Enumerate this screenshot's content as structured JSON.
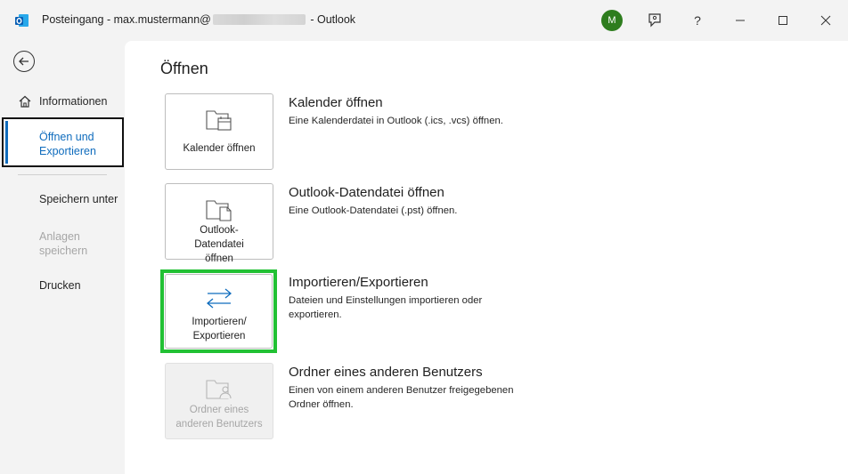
{
  "titlebar": {
    "title_prefix": "Posteingang - max.mustermann@",
    "title_suffix": "- Outlook",
    "avatar_initial": "M",
    "help_label": "?"
  },
  "nav": {
    "info_label": "Informationen",
    "open_export_label": "Öffnen und Exportieren",
    "save_as_label": "Speichern unter",
    "save_attachments_label": "Anlagen speichern",
    "print_label": "Drucken"
  },
  "main": {
    "page_title": "Öffnen",
    "options": [
      {
        "tile_label": "Kalender öffnen",
        "title": "Kalender öffnen",
        "description": "Eine Kalenderdatei in Outlook (.ics, .vcs) öffnen."
      },
      {
        "tile_label": "Outlook-Datendatei öffnen",
        "title": "Outlook-Datendatei öffnen",
        "description": "Eine Outlook-Datendatei (.pst) öffnen."
      },
      {
        "tile_label": "Importieren/ Exportieren",
        "title": "Importieren/Exportieren",
        "description": "Dateien und Einstellungen importieren oder exportieren."
      },
      {
        "tile_label": "Ordner eines anderen Benutzers",
        "title": "Ordner eines anderen Benutzers",
        "description": "Einen von einem anderen Benutzer freigegebenen Ordner öffnen."
      }
    ]
  },
  "colors": {
    "accent": "#0f6cbd",
    "highlight": "#22c134",
    "avatar": "#2e7d1e"
  }
}
